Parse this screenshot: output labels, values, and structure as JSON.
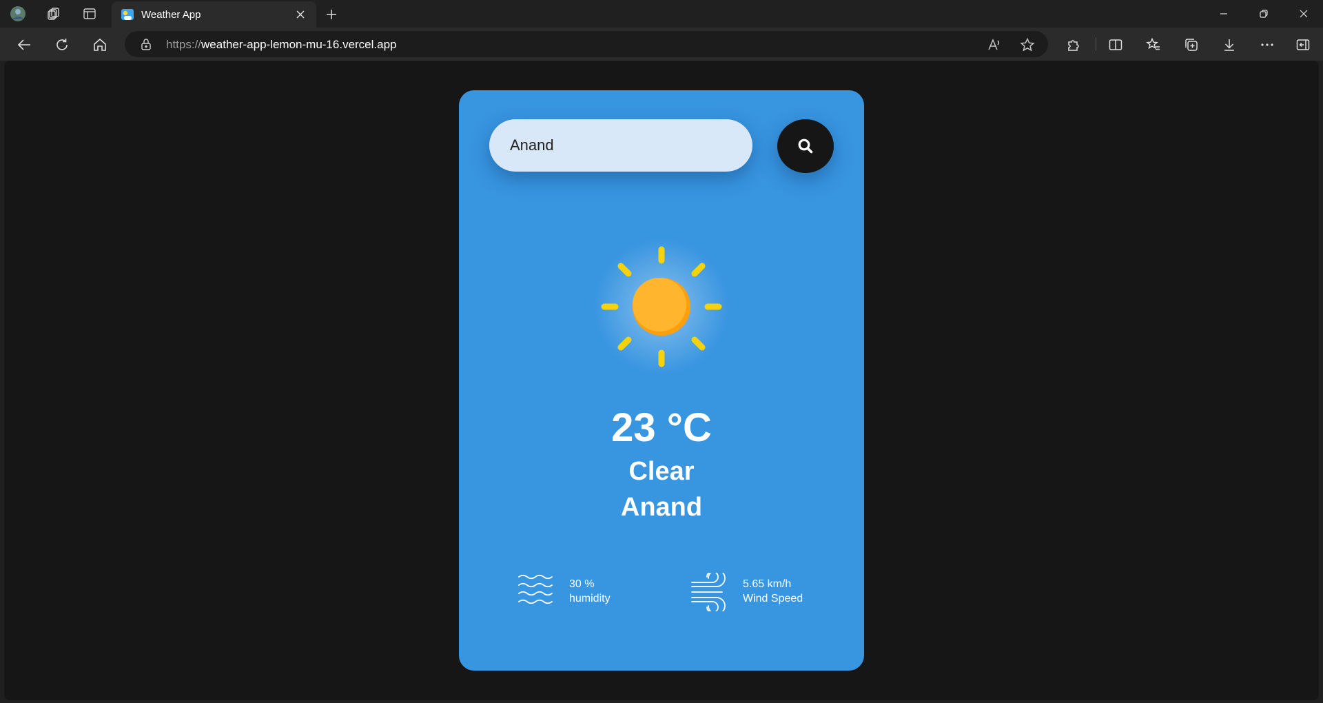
{
  "browser": {
    "tab_title": "Weather App",
    "url_scheme": "https://",
    "url_host": "weather-app-lemon-mu-16.vercel.app"
  },
  "app": {
    "search": {
      "value": "Anand",
      "placeholder": ""
    },
    "weather_icon": "sun-icon",
    "temperature": "23 °C",
    "condition": "Clear",
    "city": "Anand",
    "humidity": {
      "value": "30 %",
      "label": "humidity",
      "icon": "waves-icon"
    },
    "wind": {
      "value": "5.65 km/h",
      "label": "Wind Speed",
      "icon": "wind-icon"
    }
  },
  "colors": {
    "card": "#3895e0",
    "search_field": "#d8e8f8",
    "search_button": "#161616",
    "sun_rays": "#f5d30c",
    "sun_body": "#ffb12a"
  }
}
